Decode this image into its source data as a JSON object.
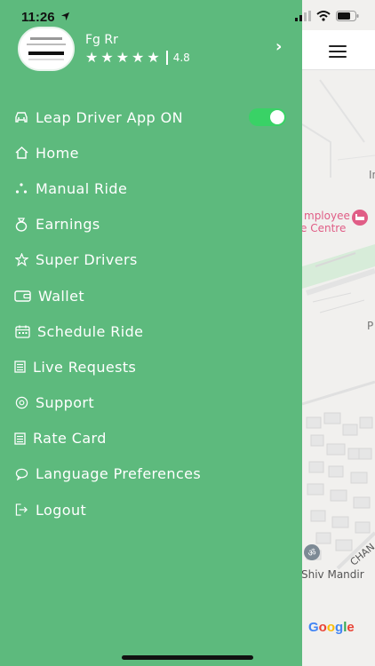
{
  "status_bar": {
    "time": "11:26"
  },
  "profile": {
    "name": "Fg Rr",
    "rating": "4.8",
    "star_count": 5
  },
  "menu": {
    "toggle_on": true,
    "accent_color": "#5dba7d",
    "items": [
      {
        "label": "Leap Driver App ON",
        "icon": "car-icon"
      },
      {
        "label": "Home",
        "icon": "home-icon"
      },
      {
        "label": "Manual Ride",
        "icon": "route-icon"
      },
      {
        "label": "Earnings",
        "icon": "money-bag-icon"
      },
      {
        "label": "Super Drivers",
        "icon": "star-icon"
      },
      {
        "label": "Wallet",
        "icon": "wallet-icon"
      },
      {
        "label": "Schedule Ride",
        "icon": "calendar-icon"
      },
      {
        "label": "Live Requests",
        "icon": "list-icon"
      },
      {
        "label": "Support",
        "icon": "support-icon"
      },
      {
        "label": "Rate Card",
        "icon": "list-icon"
      },
      {
        "label": "Language Preferences",
        "icon": "chat-icon"
      },
      {
        "label": "Logout",
        "icon": "logout-icon"
      }
    ]
  },
  "map": {
    "labels": {
      "employee_line1": "mployee",
      "employee_line2": "e Centre",
      "in": "In",
      "p": "P",
      "shiv_mandir": "Shiv Mandir",
      "chan": "CHAN"
    },
    "google": "Google"
  }
}
